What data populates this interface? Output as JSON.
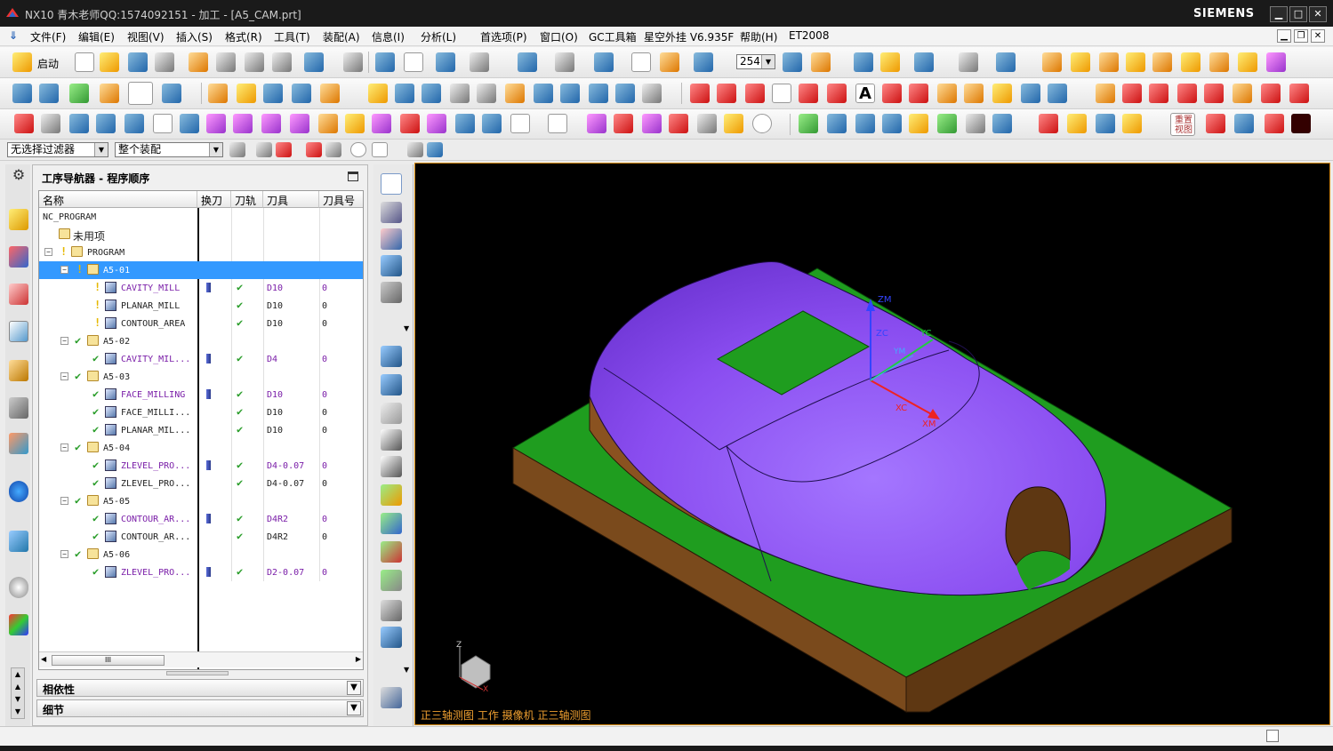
{
  "window": {
    "title": "NX10 青木老师QQ:1574092151 - 加工 - [A5_CAM.prt]",
    "brand": "SIEMENS",
    "minimize": "▁",
    "maximize": "□",
    "close": "✕"
  },
  "menu": {
    "items": [
      "文件(F)",
      "编辑(E)",
      "视图(V)",
      "插入(S)",
      "格式(R)",
      "工具(T)",
      "装配(A)",
      "信息(I)",
      "分析(L)",
      "首选项(P)",
      "窗口(O)",
      "GC工具箱",
      "星空外挂 V6.935F",
      "帮助(H)",
      "ET2008"
    ]
  },
  "toolbar": {
    "start_label": "启动",
    "layer_value": "254",
    "quickview_label": "重置视图"
  },
  "filterbar": {
    "filter_value": "无选择过滤器",
    "assembly_value": "整个装配"
  },
  "navigator": {
    "title": "工序导航器 - 程序顺序",
    "columns": [
      "名称",
      "换刀",
      "刀轨",
      "刀具",
      "刀具号"
    ],
    "rows": [
      {
        "name": "NC_PROGRAM",
        "tool": "",
        "num": ""
      },
      {
        "name": "未用项",
        "tool": "",
        "num": ""
      },
      {
        "name": "PROGRAM",
        "tool": "",
        "num": ""
      },
      {
        "name": "A5-01",
        "tool": "",
        "num": ""
      },
      {
        "name": "CAVITY_MILL",
        "tool": "D10",
        "num": "0"
      },
      {
        "name": "PLANAR_MILL",
        "tool": "D10",
        "num": "0"
      },
      {
        "name": "CONTOUR_AREA",
        "tool": "D10",
        "num": "0"
      },
      {
        "name": "A5-02",
        "tool": "",
        "num": ""
      },
      {
        "name": "CAVITY_MIL...",
        "tool": "D4",
        "num": "0"
      },
      {
        "name": "A5-03",
        "tool": "",
        "num": ""
      },
      {
        "name": "FACE_MILLING",
        "tool": "D10",
        "num": "0"
      },
      {
        "name": "FACE_MILLI...",
        "tool": "D10",
        "num": "0"
      },
      {
        "name": "PLANAR_MIL...",
        "tool": "D10",
        "num": "0"
      },
      {
        "name": "A5-04",
        "tool": "",
        "num": ""
      },
      {
        "name": "ZLEVEL_PRO...",
        "tool": "D4-0.07",
        "num": "0"
      },
      {
        "name": "ZLEVEL_PRO...",
        "tool": "D4-0.07",
        "num": "0"
      },
      {
        "name": "A5-05",
        "tool": "",
        "num": ""
      },
      {
        "name": "CONTOUR_AR...",
        "tool": "D4R2",
        "num": "0"
      },
      {
        "name": "CONTOUR_AR...",
        "tool": "D4R2",
        "num": "0"
      },
      {
        "name": "A5-06",
        "tool": "",
        "num": ""
      },
      {
        "name": "ZLEVEL_PRO...",
        "tool": "D2-0.07",
        "num": "0"
      }
    ],
    "scroll_thumb": "III",
    "dependencies_label": "相依性",
    "details_label": "细节"
  },
  "viewport": {
    "label": "正三轴测图 工作 摄像机 正三轴测图",
    "axis_zm": "ZM",
    "axis_zc": "ZC",
    "axis_xc": "XC",
    "axis_xm": "XM",
    "axis_yc": "YC",
    "axis_ym": "YM",
    "triad_z": "Z",
    "triad_x": "X",
    "colors": {
      "body": "#8a4df0",
      "base": "#1f9d1f",
      "side": "#7a4a1c"
    }
  }
}
